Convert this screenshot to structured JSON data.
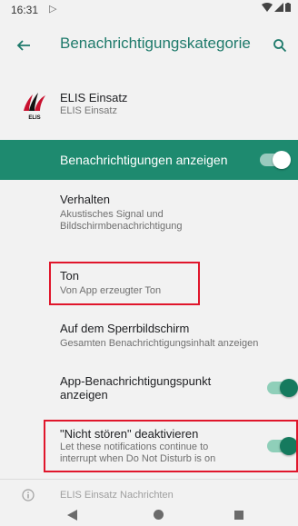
{
  "status": {
    "time": "16:31"
  },
  "appbar": {
    "title": "Benachrichtigungskategorie"
  },
  "app": {
    "name": "ELIS Einsatz",
    "subtitle": "ELIS Einsatz",
    "logo_text": "ELIS"
  },
  "master": {
    "label": "Benachrichtigungen anzeigen",
    "enabled": true
  },
  "settings": [
    {
      "title": "Verhalten",
      "subtitle": "Akustisches Signal und Bildschirmbenachrichtigung"
    },
    {
      "title": "Ton",
      "subtitle": "Von App erzeugter Ton"
    },
    {
      "title": "Auf dem Sperrbildschirm",
      "subtitle": "Gesamten Benachrichtigungsinhalt anzeigen"
    },
    {
      "title": "App-Benachrichtigungspunkt anzeigen",
      "enabled": true
    },
    {
      "title": "\"Nicht stören\" deaktivieren",
      "subtitle": "Let these notifications continue to interrupt when Do Not Disturb is on",
      "enabled": true
    }
  ],
  "footer": {
    "text": "ELIS Einsatz Nachrichten"
  },
  "colors": {
    "accent": "#1e8a6f",
    "title": "#1e7a6b",
    "highlight": "#e0162b"
  }
}
